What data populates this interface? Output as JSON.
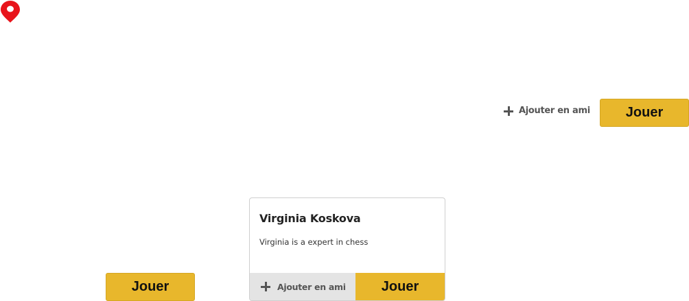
{
  "icons": {
    "pin": "location-pin-icon",
    "plus": "plus-icon"
  },
  "colors": {
    "pin": "#e8141b",
    "play_button": "#e8b72c",
    "footer_gray": "#e4e4e4"
  },
  "floating_actions": {
    "add_friend_label": "Ajouter en ami",
    "play_label": "Jouer"
  },
  "standalone_play": {
    "label": "Jouer"
  },
  "card": {
    "name": "Virginia Koskova",
    "description": "Virginia is a expert in chess",
    "add_friend_label": "Ajouter en ami",
    "play_label": "Jouer"
  }
}
